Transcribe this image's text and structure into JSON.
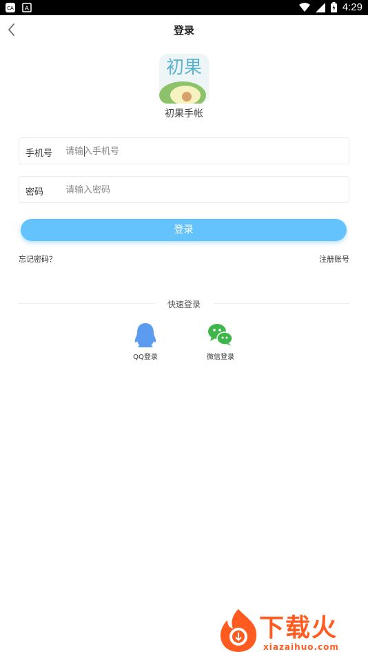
{
  "status_bar": {
    "time": "4:29",
    "left_icons": [
      "ca-icon",
      "a-icon"
    ],
    "right_icons": [
      "wifi-icon",
      "signal-icon",
      "battery-icon"
    ]
  },
  "header": {
    "title": "登录",
    "back_icon": "chevron-left-icon"
  },
  "app": {
    "logo_text": "初果",
    "name": "初果手帐"
  },
  "form": {
    "phone": {
      "label": "手机号",
      "placeholder": "请输入手机号"
    },
    "password": {
      "label": "密码",
      "placeholder": "请输入密码"
    },
    "submit_label": "登录"
  },
  "links": {
    "forgot": "忘记密码？",
    "register": "注册账号"
  },
  "quick_login": {
    "title": "快速登录",
    "options": [
      {
        "label": "QQ登录",
        "icon": "qq-penguin-icon",
        "color": "#5b9bf0"
      },
      {
        "label": "微信登录",
        "icon": "wechat-icon",
        "color": "#3fb649"
      }
    ]
  },
  "watermark": {
    "text": "下载火",
    "domain": "xiazaihuo.com"
  },
  "colors": {
    "accent": "#64c3fd",
    "watermark": "#ff5a1f"
  }
}
